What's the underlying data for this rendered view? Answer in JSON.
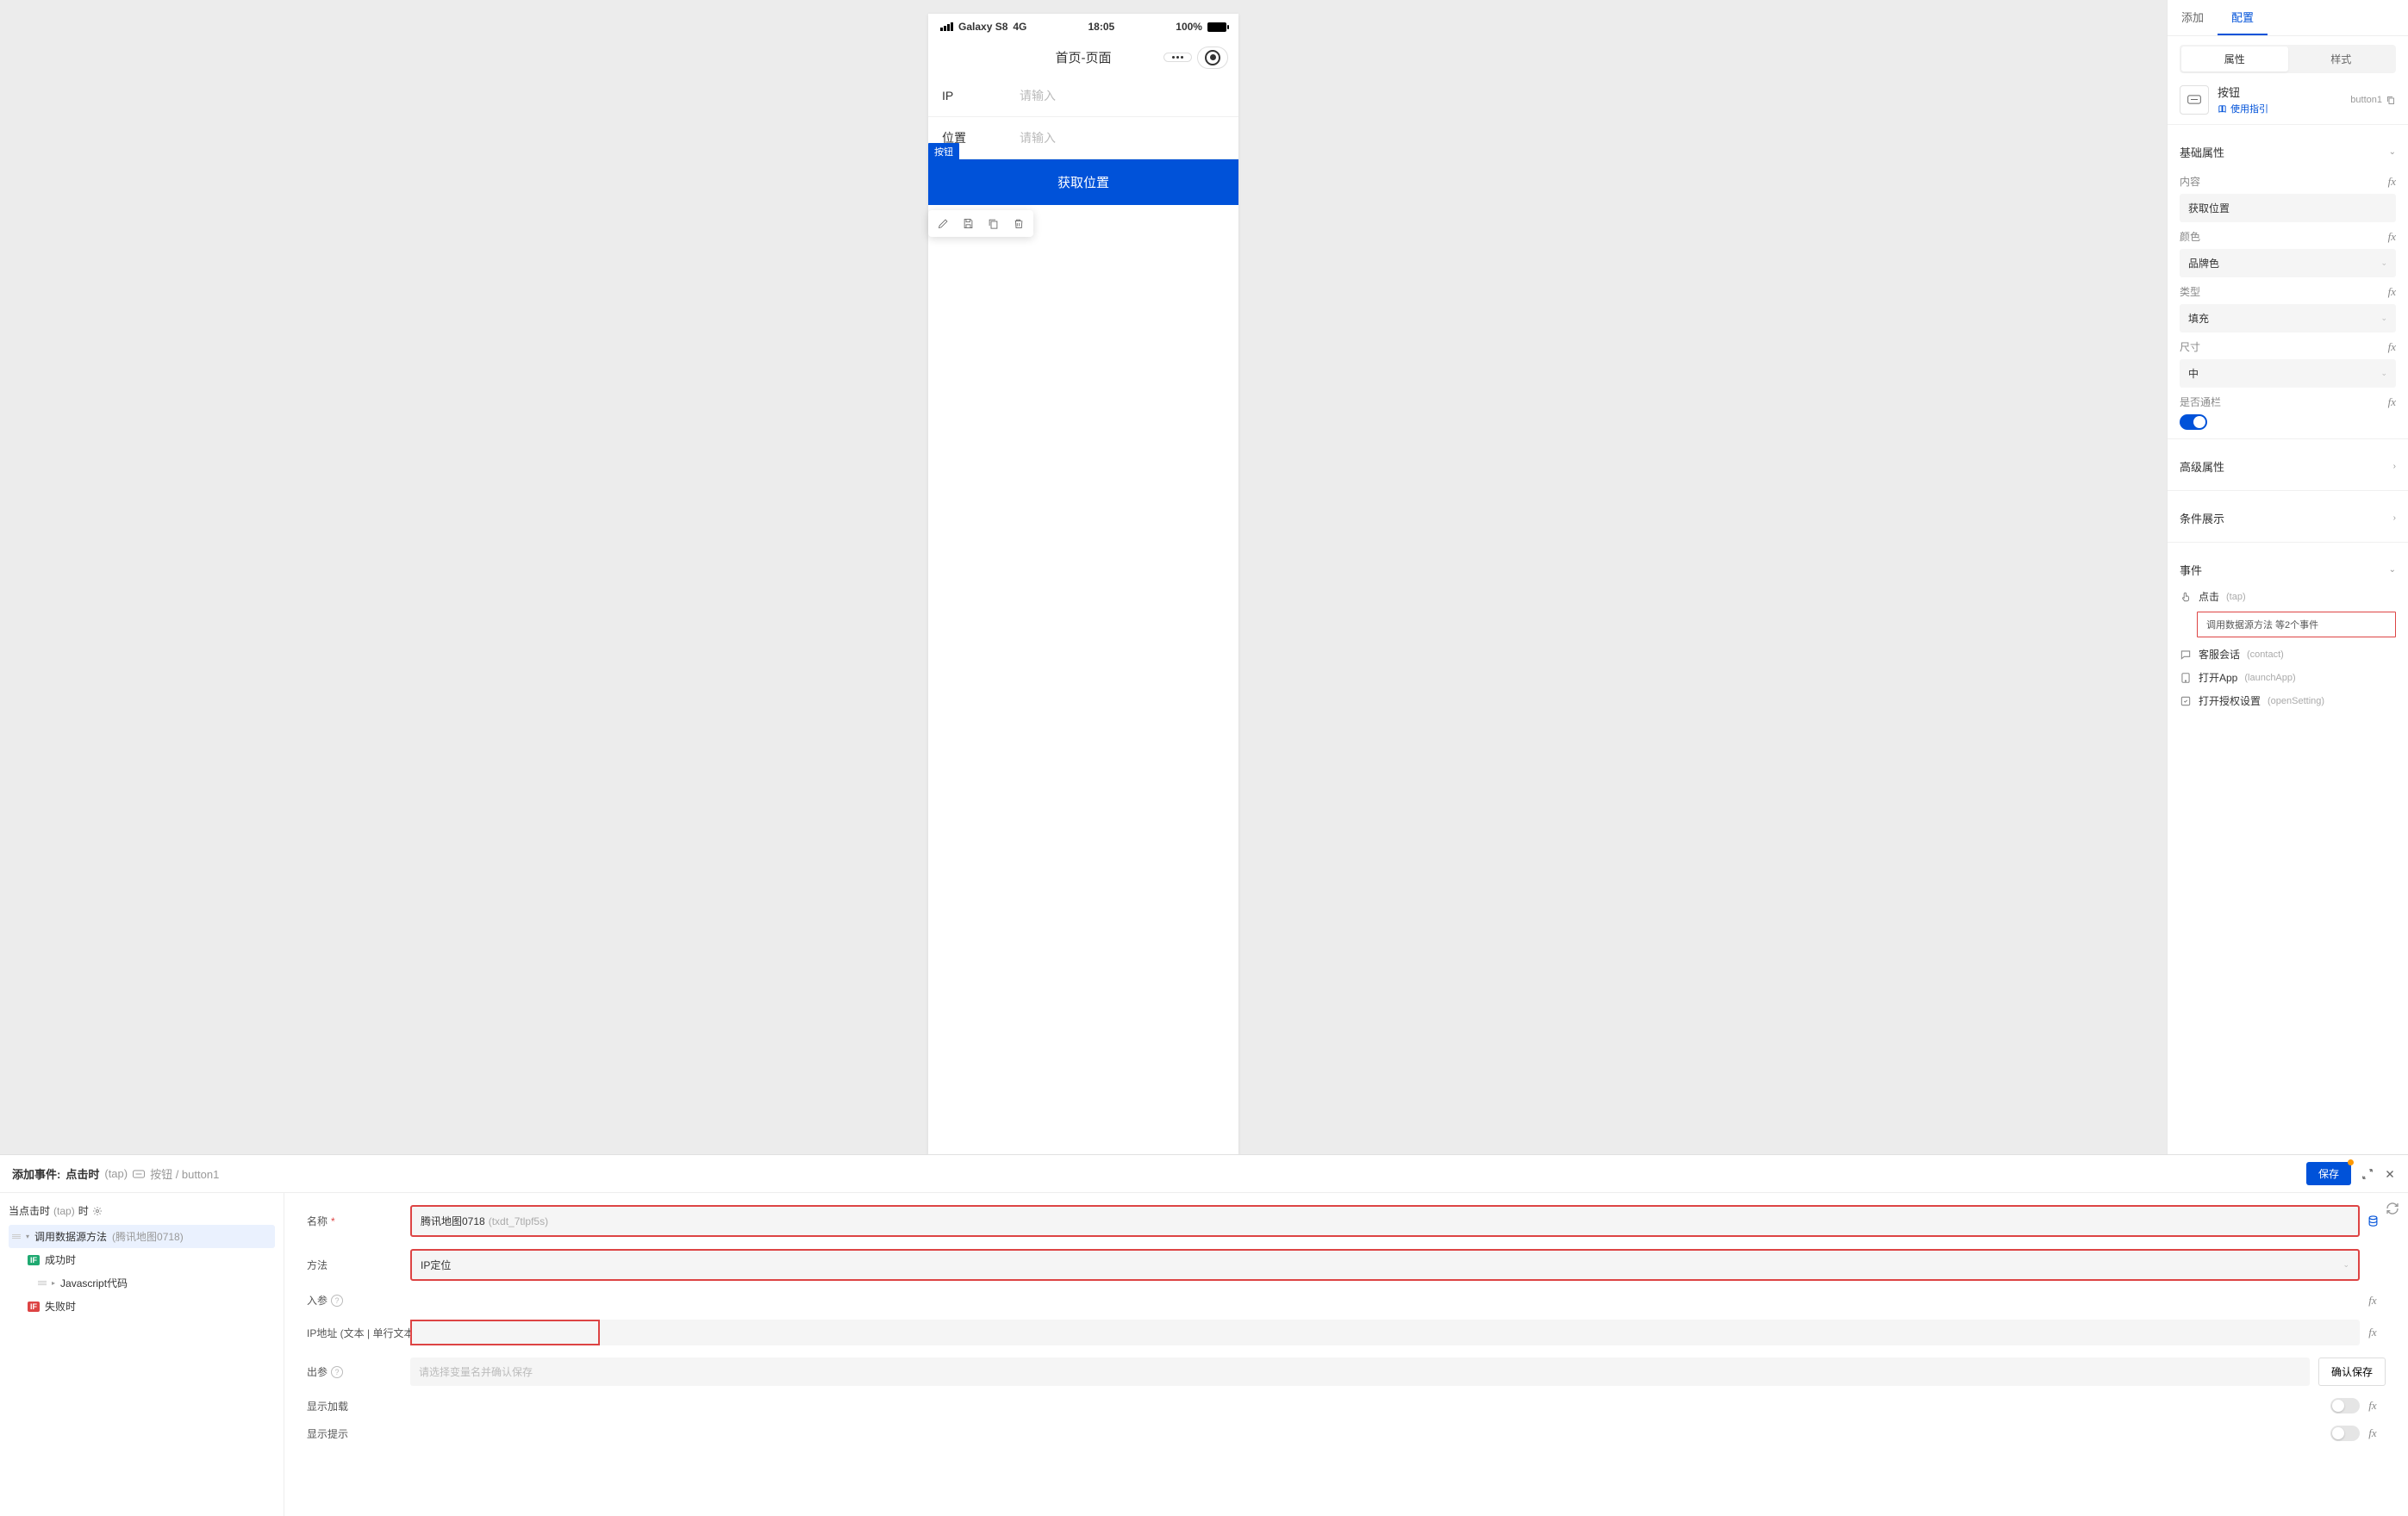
{
  "phone": {
    "device": "Galaxy S8",
    "network": "4G",
    "time": "18:05",
    "battery": "100%",
    "page_title": "首页-页面",
    "fields": [
      {
        "label": "IP",
        "placeholder": "请输入"
      },
      {
        "label": "位置",
        "placeholder": "请输入"
      }
    ],
    "selected_tag": "按钮",
    "button_text": "获取位置"
  },
  "right": {
    "tabs": {
      "add": "添加",
      "config": "配置"
    },
    "segmented": {
      "attr": "属性",
      "style": "样式"
    },
    "component": {
      "title": "按钮",
      "id": "button1",
      "guide": "使用指引"
    },
    "sections": {
      "basic": "基础属性",
      "content_label": "内容",
      "content_value": "获取位置",
      "color_label": "颜色",
      "color_value": "品牌色",
      "type_label": "类型",
      "type_value": "填充",
      "size_label": "尺寸",
      "size_value": "中",
      "full_label": "是否通栏",
      "advanced": "高级属性",
      "condition": "条件展示",
      "events": "事件"
    },
    "events": {
      "tap": {
        "name": "点击",
        "code": "(tap)",
        "box": "调用数据源方法 等2个事件"
      },
      "contact": {
        "name": "客服会话",
        "code": "(contact)"
      },
      "launch": {
        "name": "打开App",
        "code": "(launchApp)"
      },
      "open": {
        "name": "打开授权设置",
        "code": "(openSetting)"
      }
    }
  },
  "bottom": {
    "header": {
      "prefix": "添加事件:",
      "event": "点击时",
      "event_code": "(tap)",
      "comp": "按钮 / button1",
      "save": "保存"
    },
    "tree": {
      "title_a": "当点击时",
      "title_code": "(tap)",
      "title_b": "时",
      "row0": {
        "label": "调用数据源方法",
        "meta": "(腾讯地图0718)"
      },
      "row1": {
        "badge": "IF",
        "label": "成功时"
      },
      "row2": {
        "label": "Javascript代码"
      },
      "row3": {
        "badge": "IF",
        "label": "失败时"
      }
    },
    "form": {
      "name_label": "名称",
      "name_value": "腾讯地图0718",
      "name_id": "(txdt_7tlpf5s)",
      "method_label": "方法",
      "method_value": "IP定位",
      "param_label": "入参",
      "ip_label": "IP地址 (文本 | 单行文本",
      "out_label": "出参",
      "out_placeholder": "请选择变量名并确认保存",
      "confirm": "确认保存",
      "show_loading": "显示加载",
      "show_tip": "显示提示"
    }
  }
}
